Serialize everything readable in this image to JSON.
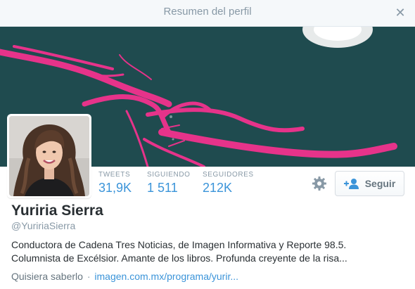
{
  "modal": {
    "title": "Resumen del perfil",
    "close_icon": "close-icon"
  },
  "profile": {
    "name": "Yuriria Sierra",
    "handle": "@YuririaSierra",
    "bio_lines": [
      "Conductora de Cadena Tres Noticias, de Imagen Informativa y Reporte 98.5.",
      "Columnista de Excélsior. Amante de los libros. Profunda creyente de la risa..."
    ],
    "location": "Quisiera saberlo",
    "separator": "·",
    "website": "imagen.com.mx/programa/yurir..."
  },
  "stats": [
    {
      "label": "TWEETS",
      "value": "31,9K"
    },
    {
      "label": "SIGUIENDO",
      "value": "1 511"
    },
    {
      "label": "SEGUIDORES",
      "value": "212K"
    }
  ],
  "actions": {
    "settings_icon": "gear-icon",
    "follow_icon": "add-user-icon",
    "follow_label": "Seguir"
  },
  "colors": {
    "banner_bg": "#1f4b4f",
    "banner_accent": "#e6338a",
    "link": "#3b94d9"
  }
}
